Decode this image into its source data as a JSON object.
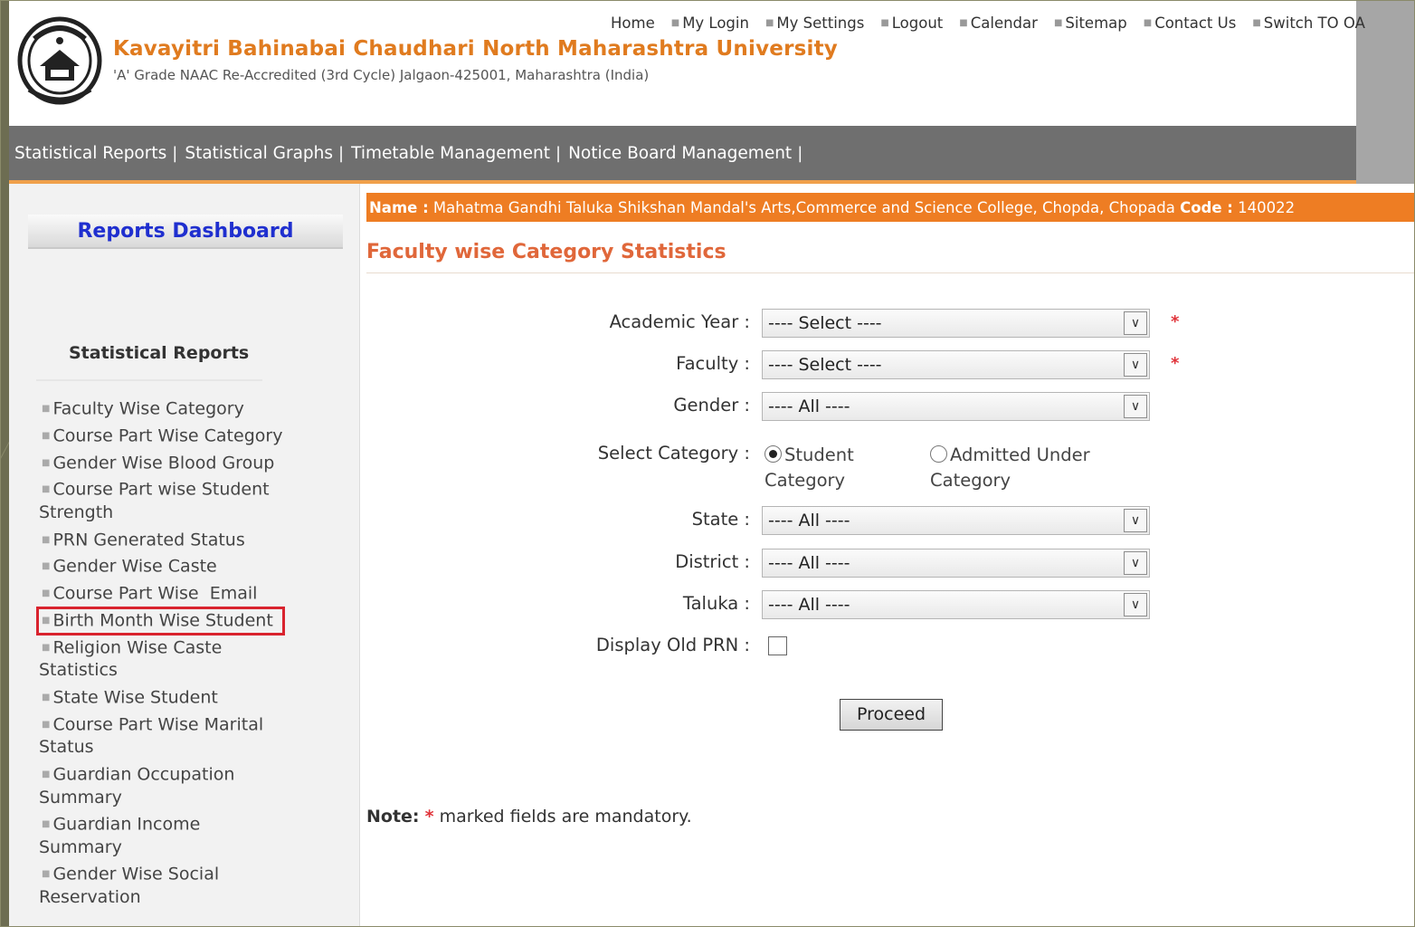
{
  "header": {
    "university_name": "Kavayitri Bahinabai Chaudhari North Maharashtra University",
    "subtitle": "'A' Grade NAAC Re-Accredited (3rd Cycle) Jalgaon-425001, Maharashtra (India)",
    "links": [
      "Home",
      "My Login",
      "My Settings",
      "Logout",
      "Calendar",
      "Sitemap",
      "Contact Us",
      "Switch TO OA"
    ]
  },
  "navbar": {
    "items": [
      "Statistical Reports",
      "Statistical Graphs",
      "Timetable Management",
      "Notice Board Management"
    ]
  },
  "sidebar": {
    "dashboard_label": "Reports Dashboard",
    "section_title": "Statistical Reports",
    "items": [
      "Faculty Wise Category",
      "Course Part Wise Category",
      "Gender Wise Blood Group",
      "Course Part wise Student Strength",
      "PRN Generated Status",
      "Gender Wise Caste",
      "Course Part Wise  Email",
      "Birth Month Wise Student",
      "Religion Wise Caste Statistics",
      "State Wise Student",
      "Course Part Wise Marital Status",
      "Guardian Occupation Summary",
      "Guardian Income Summary",
      "Gender Wise Social Reservation"
    ],
    "highlighted_index": 7
  },
  "college": {
    "name_label": "Name :",
    "name": "Mahatma Gandhi Taluka Shikshan Mandal's Arts,Commerce and Science College, Chopda, Chopada",
    "code_label": "Code :",
    "code": "140022"
  },
  "page_title": "Faculty wise Category Statistics",
  "form": {
    "academic_year": {
      "label": "Academic Year :",
      "value": "---- Select ----"
    },
    "faculty": {
      "label": "Faculty :",
      "value": "---- Select ----"
    },
    "gender": {
      "label": "Gender :",
      "value": "---- All ----"
    },
    "category": {
      "label": "Select Category :",
      "option1": "Student Category",
      "option2": "Admitted Under Category",
      "selected": "Student Category"
    },
    "state": {
      "label": "State :",
      "value": "---- All ----"
    },
    "district": {
      "label": "District :",
      "value": "---- All ----"
    },
    "taluka": {
      "label": "Taluka :",
      "value": "---- All ----"
    },
    "old_prn": {
      "label": "Display Old PRN :",
      "checked": false
    },
    "proceed_label": "Proceed",
    "required_mark": "*"
  },
  "note": {
    "label": "Note:",
    "star": "*",
    "text": "marked fields are mandatory."
  },
  "colors": {
    "brand_orange": "#ee7d23",
    "title_orange": "#e0673a",
    "nav_gray": "#6f6f6f",
    "link_blue": "#1f2fcf",
    "highlight_red": "#d9232e"
  }
}
